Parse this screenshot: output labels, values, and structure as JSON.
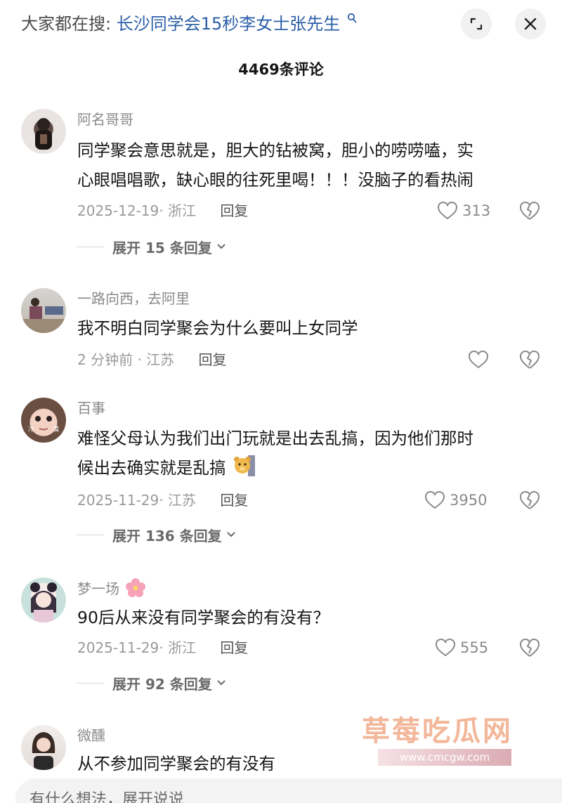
{
  "search": {
    "prefix": "大家都在搜:",
    "term": "长沙同学会15秒李女士张先生"
  },
  "comment_count": "4469条评论",
  "comments": [
    {
      "user": "阿名哥哥",
      "lines": [
        "同学聚会意思就是，胆大的钻被窝，胆小的唠唠嗑，实",
        "心眼唱唱歌，缺心眼的往死里喝！！！没脑子的看热闹"
      ],
      "meta": "2025-12-19· 浙江",
      "reply": "回复",
      "likes": "313",
      "expand": "展开 15 条回复"
    },
    {
      "user": "一路向西，去阿里",
      "lines": [
        "我不明白同学聚会为什么要叫上女同学"
      ],
      "meta": "2 分钟前 · 江苏",
      "reply": "回复",
      "likes": ""
    },
    {
      "user": "百事",
      "avatar_text": [
        "冷",
        "漠"
      ],
      "lines": [
        "难怪父母认为我们出门玩就是出去乱搞，因为他们那时",
        "候出去确实就是乱搞"
      ],
      "meta": "2025-11-29· 江苏",
      "reply": "回复",
      "likes": "3950",
      "expand": "展开 136 条回复"
    },
    {
      "user": "梦一场",
      "lines": [
        "90后从来没有同学聚会的有没有？"
      ],
      "meta": "2025-11-29· 浙江",
      "reply": "回复",
      "likes": "555",
      "expand": "展开 92 条回复"
    },
    {
      "user": "微醺",
      "lines": [
        "从不参加同学聚会的有没有"
      ]
    }
  ],
  "watermark": {
    "text": "草莓吃瓜网",
    "url": "www.cmcgw.com"
  },
  "input": {
    "placeholder": "有什么想法，展开说说"
  },
  "colors": {
    "search_term": "#2c5fa8",
    "username": "#8a8a8a",
    "body_text": "#161616"
  }
}
